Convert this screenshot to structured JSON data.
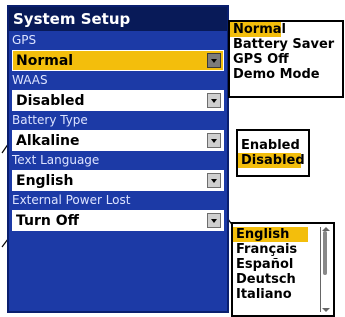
{
  "title": "System Setup",
  "fields": [
    {
      "label": "GPS",
      "value": "Normal"
    },
    {
      "label": "WAAS",
      "value": "Disabled"
    },
    {
      "label": "Battery Type",
      "value": "Alkaline"
    },
    {
      "label": "Text Language",
      "value": "English"
    },
    {
      "label": "External Power Lost",
      "value": "Turn Off"
    }
  ],
  "popups": {
    "gps_options": [
      "Normal",
      "Battery Saver",
      "GPS Off",
      "Demo Mode"
    ],
    "waas_options": [
      "Enabled",
      "Disabled"
    ],
    "language_options": [
      "English",
      "Français",
      "Español",
      "Deutsch",
      "Italiano"
    ]
  },
  "colors": {
    "screen_bg": "#1c3aa6",
    "title_bg": "#081a58",
    "highlight": "#f3be0c"
  }
}
